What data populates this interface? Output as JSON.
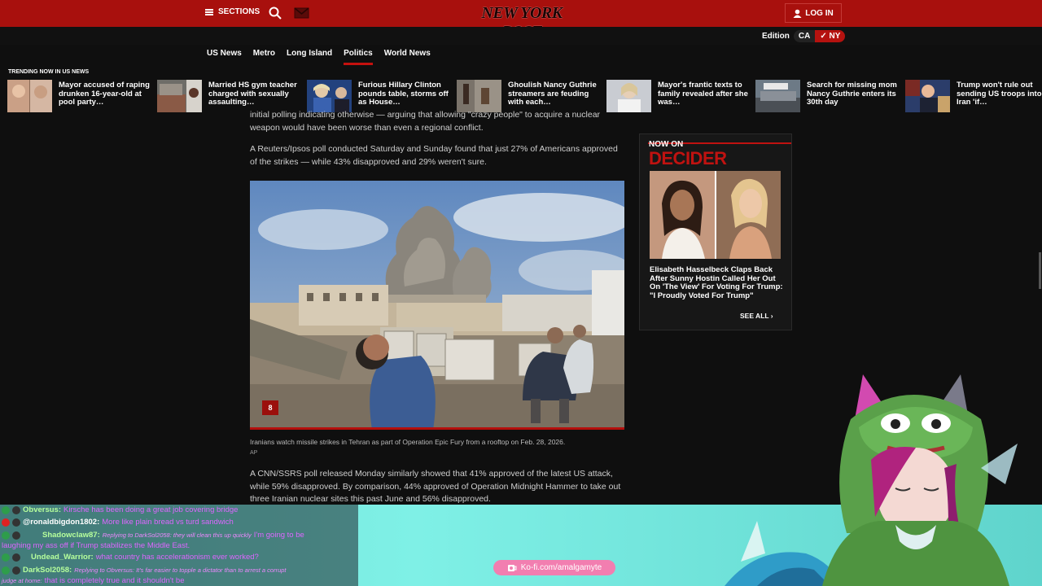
{
  "header": {
    "sections_label": "SECTIONS",
    "logo_text": "NEW YORK POST",
    "login_label": "LOG IN"
  },
  "edition": {
    "label": "Edition",
    "options": [
      "CA",
      "✓ NY"
    ]
  },
  "nav": {
    "items": [
      "US News",
      "Metro",
      "Long Island",
      "Politics",
      "World News"
    ],
    "active": "Politics"
  },
  "trending": {
    "label": "TRENDING NOW IN US NEWS",
    "items": [
      {
        "title": "Mayor accused of raping drunken 16-year-old at pool party…"
      },
      {
        "title": "Married HS gym teacher charged with sexually assaulting…"
      },
      {
        "title": "Furious Hillary Clinton pounds table, storms off as House…"
      },
      {
        "title": "Ghoulish Nancy Guthrie streamers are feuding with each…"
      },
      {
        "title": "Mayor's frantic texts to family revealed after she was…"
      },
      {
        "title": "Search for missing mom Nancy Guthrie enters its 30th day"
      },
      {
        "title": "Trump won't rule out sending US troops into Iran 'if…"
      }
    ]
  },
  "article": {
    "para1": "initial polling indicating otherwise — arguing that allowing \"crazy people\" to acquire a nuclear weapon would have been worse than even a regional conflict.",
    "para2": "A Reuters/Ipsos poll conducted Saturday and Sunday found that just 27% of Americans approved of the strikes — while 43% disapproved and 29% weren't sure.",
    "photo_count": "8",
    "caption": "Iranians watch missile strikes in Tehran as part of Operation Epic Fury from a rooftop on Feb. 28, 2026.",
    "credit": "AP",
    "para3": "A CNN/SSRS poll released Monday similarly showed that 41% approved of the latest US attack, while 59% disapproved. By comparison, 44% approved of Operation Midnight Hammer to take out three Iranian nuclear sites this past June and 56% disapproved."
  },
  "sidebar": {
    "now_on": "NOW ON",
    "brand": "DECIDER",
    "title": "Elisabeth Hasselbeck Claps Back After Sunny Hostin Called Her Out On 'The View' For Voting For Trump: \"I Proudly Voted For Trump\"",
    "see_all": "SEE ALL ›"
  },
  "chat": {
    "lines": [
      {
        "user": "Obversus:",
        "text": "Kirsche has been doing a great job covering bridge",
        "reply": ""
      },
      {
        "user": "@ronaldbigdon1802:",
        "text": "More like plain bread vs turd sandwich",
        "reply": ""
      },
      {
        "user": "Shadowclaw87:",
        "text": "I'm going to be",
        "reply": "Replying to DarkSol2058: they will clean this up quickly"
      },
      {
        "user": "",
        "text": "laughing my ass off if Trump stabilizes the Middle East.",
        "reply": ""
      },
      {
        "user": "Undead_Warrior:",
        "text": "what country has accelerationism ever worked?",
        "reply": ""
      },
      {
        "user": "DarkSol2058:",
        "text": "",
        "reply": "Replying to Obversus: It's far easier to topple a dictator than to arrest a corrupt"
      },
      {
        "user": "",
        "text": "that is completely true and it shouldn't be",
        "reply": "judge at home:"
      }
    ]
  },
  "kofi": {
    "label": "Ko-fi.com/amalgamyte"
  }
}
